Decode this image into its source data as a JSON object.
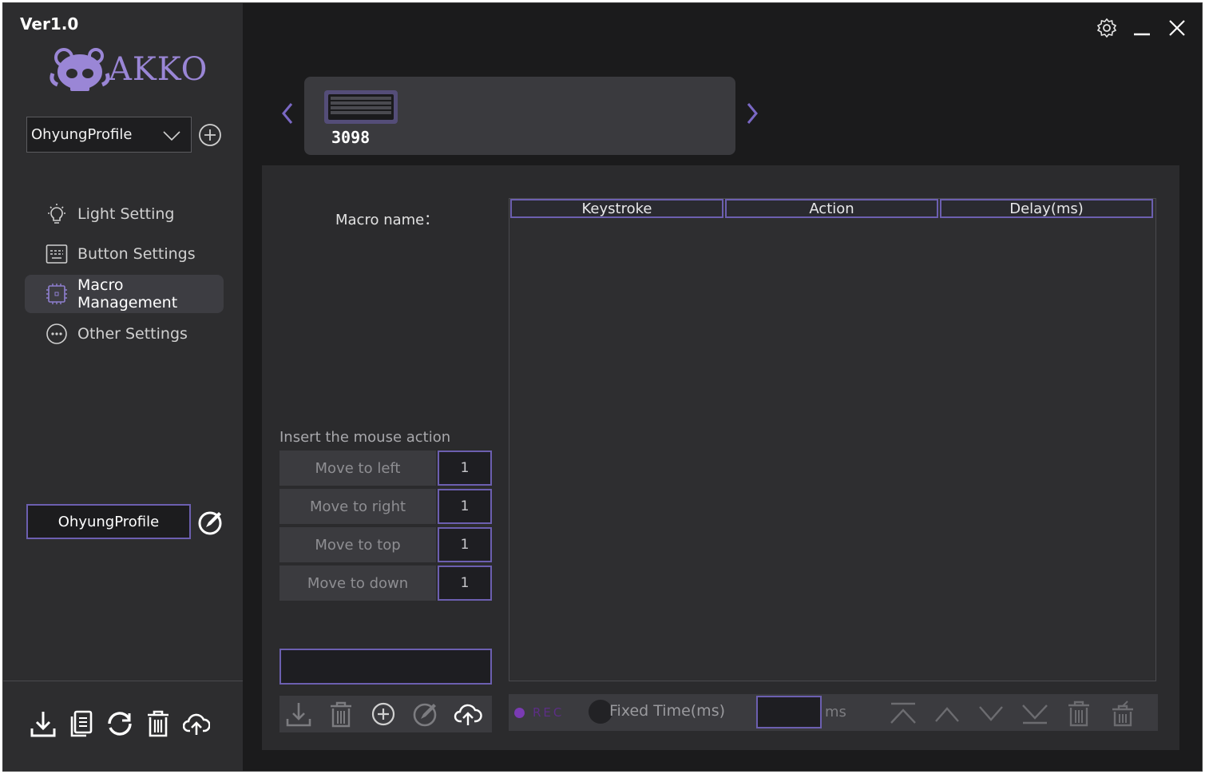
{
  "app": {
    "version": "Ver1.0",
    "logo_text": "AKKO"
  },
  "profile": {
    "selected": "OhyungProfile",
    "name_field": "OhyungProfile"
  },
  "nav": {
    "items": [
      {
        "label": "Light Setting",
        "icon": "light-bulb-icon"
      },
      {
        "label": "Button Settings",
        "icon": "keyboard-icon"
      },
      {
        "label": "Macro Management",
        "icon": "chip-icon",
        "active": true
      },
      {
        "label": "Other Settings",
        "icon": "more-dots-icon"
      }
    ]
  },
  "device": {
    "name": "3098"
  },
  "macro": {
    "name_label": "Macro name：",
    "mouse_section_label": "Insert the mouse action",
    "mouse_actions": [
      {
        "label": "Move to left",
        "value": "1"
      },
      {
        "label": "Move to right",
        "value": "1"
      },
      {
        "label": "Move to top",
        "value": "1"
      },
      {
        "label": "Move to down",
        "value": "1"
      }
    ],
    "table_headers": [
      "Keystroke",
      "Action",
      "Delay(ms)"
    ]
  },
  "record_bar": {
    "rec_label": "REC",
    "fixed_time_label": "Fixed Time(ms)",
    "fixed_time_value": "",
    "ms_label": "ms"
  },
  "colors": {
    "accent": "#6c5fb0",
    "background": "#1b1b1c",
    "sidebar": "#2d2d2f",
    "rec": "#7a3bb3"
  }
}
